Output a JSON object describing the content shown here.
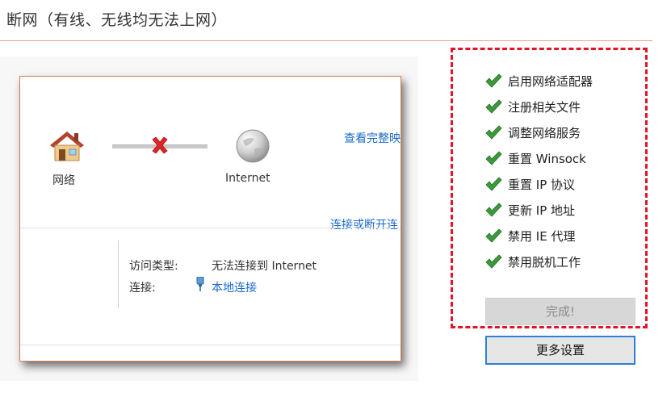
{
  "page_title": "断网（有线、无线均无法上网）",
  "network_panel": {
    "network_label": "网络",
    "internet_label": "Internet",
    "view_full_link": "查看完整映",
    "connect_link": "连接或断开连",
    "access_type_label": "访问类型:",
    "access_type_value": "无法连接到 Internet",
    "connection_label": "连接:",
    "connection_value": "本地连接"
  },
  "repair_steps": [
    {
      "label": "启用网络适配器",
      "status": "done"
    },
    {
      "label": "注册相关文件",
      "status": "done"
    },
    {
      "label": "调整网络服务",
      "status": "done"
    },
    {
      "label": "重置 Winsock",
      "status": "done"
    },
    {
      "label": "重置 IP 协议",
      "status": "done"
    },
    {
      "label": "更新 IP 地址",
      "status": "done"
    },
    {
      "label": "禁用 IE 代理",
      "status": "done"
    },
    {
      "label": "禁用脱机工作",
      "status": "done"
    }
  ],
  "buttons": {
    "done_label": "完成!",
    "more_settings_label": "更多设置"
  },
  "colors": {
    "accent_red": "#e0152a",
    "link_blue": "#1b6ac9",
    "check_green": "#3a9b3a",
    "button_border_blue": "#2f7fd4"
  }
}
